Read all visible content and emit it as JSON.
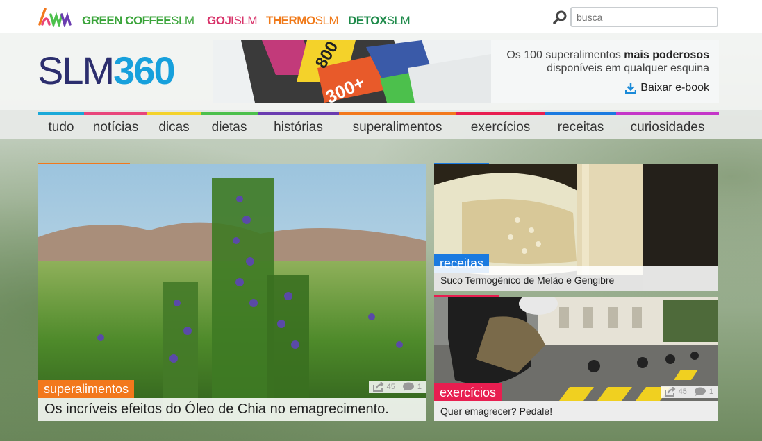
{
  "topbar": {
    "brands": [
      {
        "bold": "GREEN COFFEE",
        "thin": "SLM",
        "color": "#3aa43a"
      },
      {
        "bold": "GOJI",
        "thin": "SLM",
        "color": "#d8336a"
      },
      {
        "bold": "THERMO",
        "thin": "SLM",
        "color": "#f07a1a"
      },
      {
        "bold": "DETOX",
        "thin": "SLM",
        "color": "#1e8a4a"
      }
    ],
    "search_placeholder": "busca"
  },
  "header": {
    "logo_slm": "SLM",
    "logo_360": "360",
    "banner": {
      "line1_regular": "Os 100 superalimentos ",
      "line1_bold": "mais poderosos",
      "line2": "disponíveis em qualquer esquina",
      "download_label": "Baixar e-book"
    }
  },
  "nav": {
    "items": [
      {
        "label": "tudo",
        "color": "#19a8d8"
      },
      {
        "label": "notícias",
        "color": "#e8457a"
      },
      {
        "label": "dicas",
        "color": "#f4d22a"
      },
      {
        "label": "dietas",
        "color": "#4cc04c"
      },
      {
        "label": "histórias",
        "color": "#6a3cb0"
      },
      {
        "label": "superalimentos",
        "color": "#f2781c"
      },
      {
        "label": "exercícios",
        "color": "#e81e50"
      },
      {
        "label": "receitas",
        "color": "#1a7ae0"
      },
      {
        "label": "curiosidades",
        "color": "#c436c8"
      }
    ]
  },
  "cards": {
    "main": {
      "tag": "superalimentos",
      "tag_color": "#f2781c",
      "title": "Os incríveis efeitos do Óleo de Chia no emagrecimento.",
      "shares": "45",
      "comments": "1"
    },
    "top_right": {
      "tag": "receitas",
      "tag_color": "#1a7ae0",
      "title": "Suco Termogênico de Melão e Gengibre"
    },
    "bottom_right": {
      "tag": "exercícios",
      "tag_color": "#e81e50",
      "title": "Quer emagrecer? Pedale!",
      "shares": "45",
      "comments": "1"
    }
  }
}
